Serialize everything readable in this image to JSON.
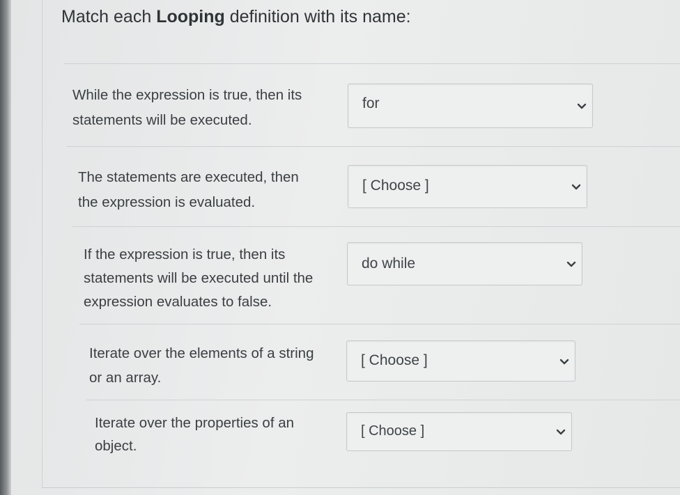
{
  "question": {
    "title_prefix": "Match each ",
    "title_bold": "Looping",
    "title_suffix": " definition with its name:"
  },
  "items": [
    {
      "definition_lines": [
        "While the expression is true, then its",
        "statements will be executed."
      ],
      "selected": "for",
      "chevron_icon": "chevron-down-icon"
    },
    {
      "definition_lines": [
        "The statements are executed, then",
        "the expression is evaluated."
      ],
      "selected": "[ Choose ]",
      "chevron_icon": "chevron-down-icon"
    },
    {
      "definition_lines": [
        "If the expression is true, then its",
        "statements will be executed until the",
        "expression evaluates to false."
      ],
      "selected": "do while",
      "chevron_icon": "chevron-down-icon"
    },
    {
      "definition_lines": [
        "Iterate over the elements of a string",
        "or an array."
      ],
      "selected": "[ Choose ]",
      "chevron_icon": "chevron-down-icon"
    },
    {
      "definition_lines": [
        "Iterate over the properties of an",
        "object."
      ],
      "selected": "[ Choose ]",
      "chevron_icon": "chevron-down-icon"
    }
  ]
}
